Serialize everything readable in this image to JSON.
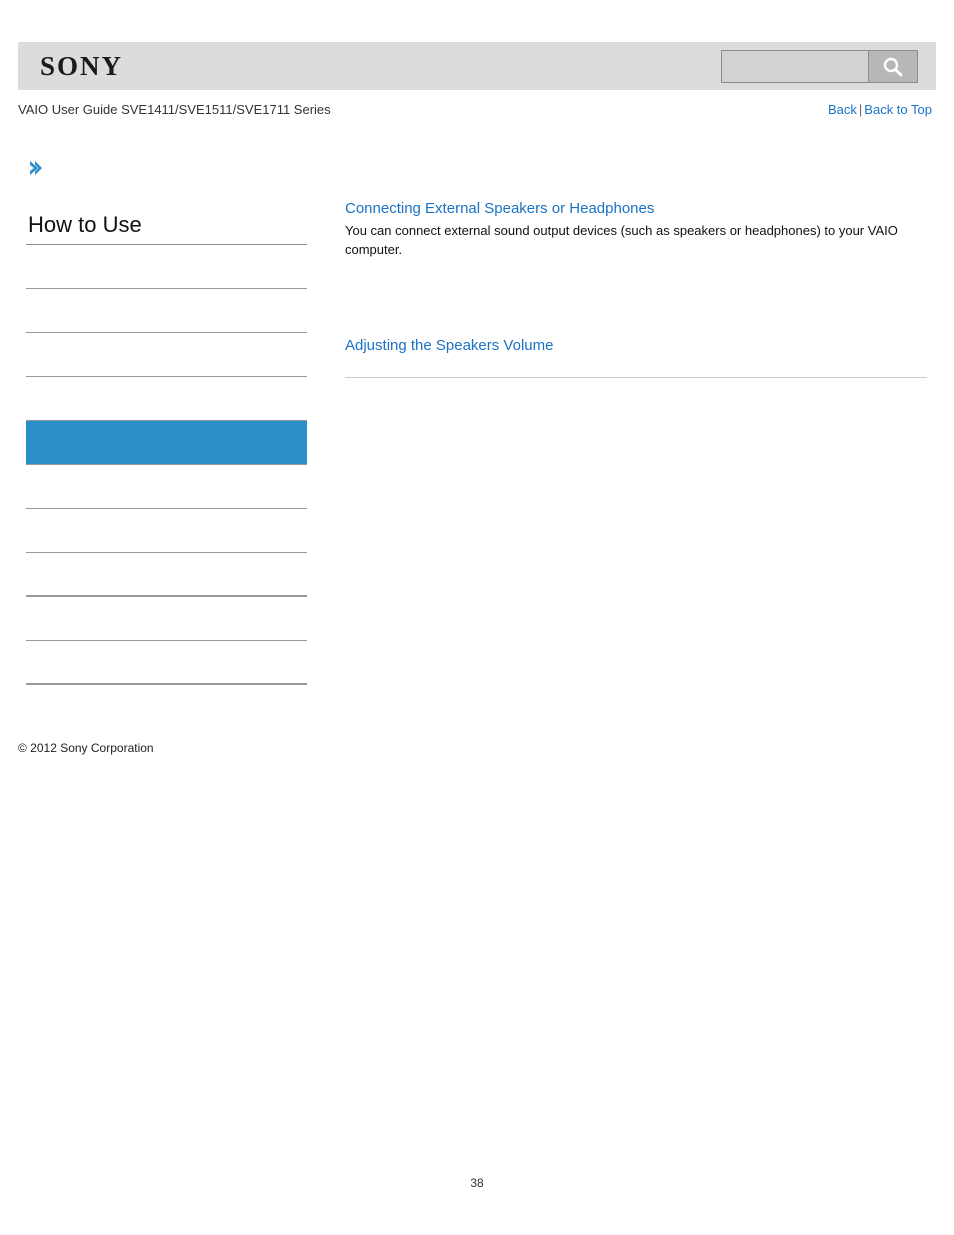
{
  "header": {
    "brand": "SONY",
    "search": {
      "value": "",
      "placeholder": "",
      "icon": "search-icon"
    }
  },
  "subheader": {
    "guide_title": "VAIO User Guide SVE1411/SVE1511/SVE1711 Series",
    "back_label": "Back",
    "separator": "|",
    "back_to_top_label": "Back to Top"
  },
  "sidebar": {
    "arrow_icon": "chevron-right-icon",
    "heading": "How to Use",
    "selected_index": 4,
    "items": [
      {
        "label": "",
        "thick": false
      },
      {
        "label": "",
        "thick": false
      },
      {
        "label": "",
        "thick": false
      },
      {
        "label": "",
        "thick": false
      },
      {
        "label": "",
        "thick": false
      },
      {
        "label": "",
        "thick": false
      },
      {
        "label": "",
        "thick": false
      },
      {
        "label": "",
        "thick": true
      },
      {
        "label": "",
        "thick": false
      },
      {
        "label": "",
        "thick": true
      }
    ],
    "copyright": "© 2012 Sony Corporation"
  },
  "content": {
    "topics": [
      {
        "title": "Connecting External Speakers or Headphones",
        "description": "You can connect external sound output devices (such as speakers or headphones) to your VAIO computer."
      },
      {
        "title": "Adjusting the Speakers Volume",
        "description": ""
      }
    ]
  },
  "footer": {
    "page_number": "38"
  },
  "colors": {
    "link": "#1b72c4",
    "selected_item": "#2b8ec9",
    "header_band": "#dcdcdc",
    "divider": "#9a9a9a"
  }
}
